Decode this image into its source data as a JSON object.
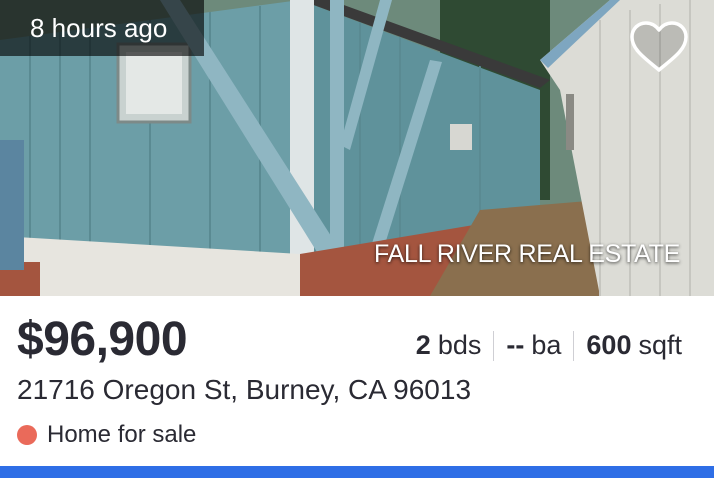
{
  "listing": {
    "time_label": "8 hours ago",
    "brokerage": "FALL RIVER REAL ESTATE",
    "price": "$96,900",
    "beds_value": "2",
    "beds_unit": "bds",
    "baths_value": "--",
    "baths_unit": "ba",
    "sqft_value": "600",
    "sqft_unit": "sqft",
    "address": "21716 Oregon St, Burney, CA 96013",
    "status": "Home for sale"
  },
  "icons": {
    "favorite": "heart-outline-icon",
    "status": "status-dot-icon"
  },
  "colors": {
    "accent": "#2e6ee6",
    "status_dot": "#ea6a5a",
    "text": "#2a2a33"
  }
}
